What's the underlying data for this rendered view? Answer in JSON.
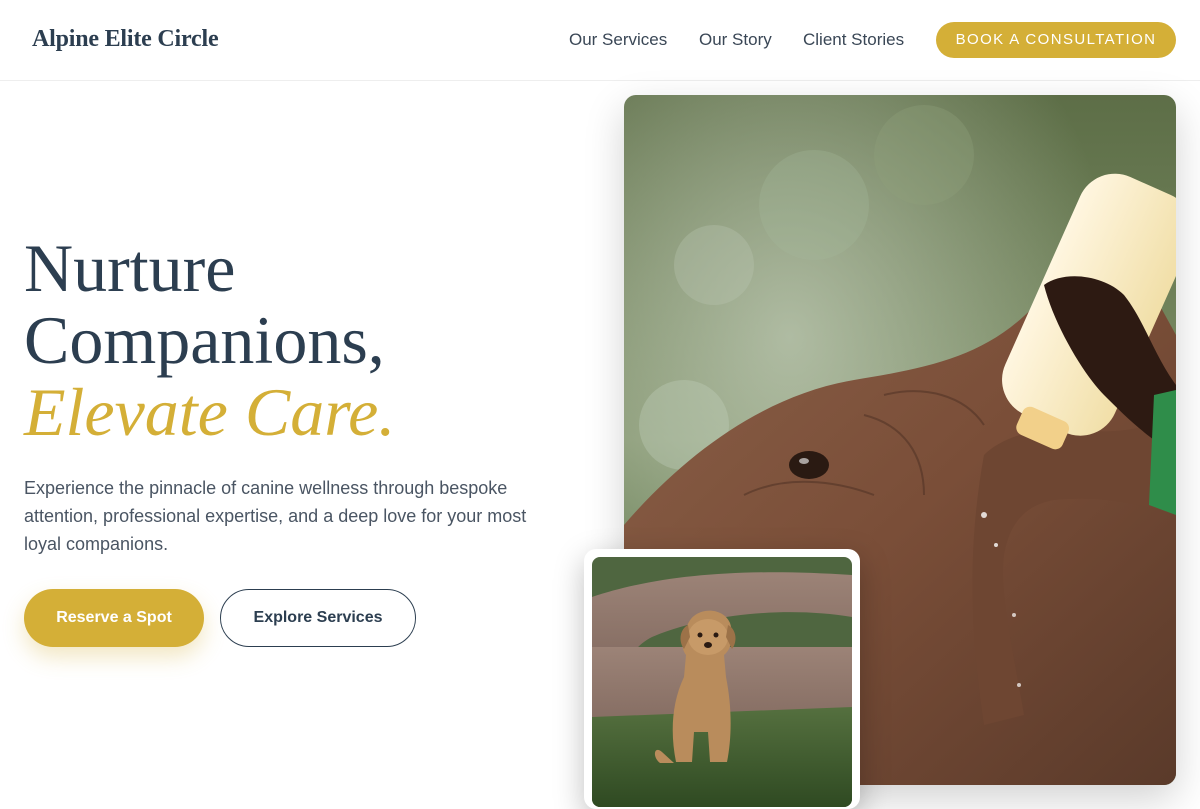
{
  "header": {
    "brand": "Alpine Elite Circle",
    "nav": [
      {
        "label": "Our Services"
      },
      {
        "label": "Our Story"
      },
      {
        "label": "Client Stories"
      }
    ],
    "cta_label": "BOOK A CONSULTATION"
  },
  "hero": {
    "title_line1": "Nurture",
    "title_line2": "Companions,",
    "title_accent": "Elevate Care.",
    "description": "Experience the pinnacle of canine wellness through bespoke attention, professional expertise, and a deep love for your most loyal companions.",
    "primary_cta": "Reserve a Spot",
    "secondary_cta": "Explore Services"
  },
  "images": {
    "main": "baby-elephant-bottle-feeding-photo",
    "secondary": "golden-retriever-sitting-photo"
  },
  "colors": {
    "accent": "#d4af37",
    "text_dark": "#2c3e50",
    "text_body": "#4a5563"
  }
}
